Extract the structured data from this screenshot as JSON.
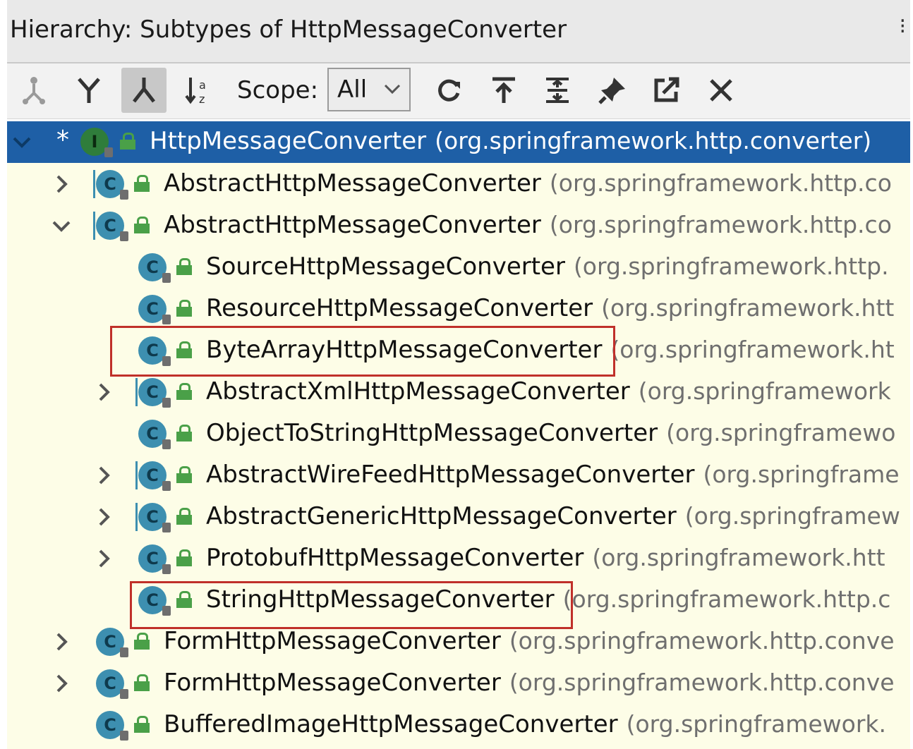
{
  "panel": {
    "title": "Hierarchy:  Subtypes of HttpMessageConverter",
    "more_icon": "more-vertical-icon",
    "colors": {
      "selection": "#1e5fa6",
      "tree_bg": "#fdfde7",
      "highlight": "#c0302a",
      "class_icon": "#3d8fb0",
      "interface_icon": "#2f7d3b"
    }
  },
  "toolbar": {
    "scope_label": "Scope:",
    "scope_value": "All",
    "buttons": [
      "type-hierarchy-icon",
      "supertypes-icon",
      "subtypes-icon",
      "sort-alphabetically-icon",
      "refresh-icon",
      "export-icon",
      "expand-all-icon",
      "pin-icon",
      "open-in-window-icon",
      "close-icon"
    ]
  },
  "tree": {
    "rows": [
      {
        "name": "HttpMessageConverter",
        "pkg": "(org.springframework.http.converter)",
        "kind": "interface",
        "expanded": true,
        "selected": true
      },
      {
        "name": "AbstractHttpMessageConverter",
        "pkg": "(org.springframework.http.co",
        "kind": "abstract",
        "expanded": false
      },
      {
        "name": "AbstractHttpMessageConverter",
        "pkg": "(org.springframework.http.co",
        "kind": "abstract",
        "expanded": true
      },
      {
        "name": "SourceHttpMessageConverter",
        "pkg": "(org.springframework.http.",
        "kind": "class"
      },
      {
        "name": "ResourceHttpMessageConverter",
        "pkg": "(org.springframework.htt",
        "kind": "class"
      },
      {
        "name": "ByteArrayHttpMessageConverter",
        "pkg": "(org.springframework.ht",
        "kind": "class",
        "highlighted": true
      },
      {
        "name": "AbstractXmlHttpMessageConverter",
        "pkg": "(org.springframework",
        "kind": "abstract",
        "expanded": false
      },
      {
        "name": "ObjectToStringHttpMessageConverter",
        "pkg": "(org.springframewo",
        "kind": "class"
      },
      {
        "name": "AbstractWireFeedHttpMessageConverter",
        "pkg": "(org.springframe",
        "kind": "abstract",
        "expanded": false
      },
      {
        "name": "AbstractGenericHttpMessageConverter",
        "pkg": "(org.springframew",
        "kind": "abstract",
        "expanded": false
      },
      {
        "name": "ProtobufHttpMessageConverter",
        "pkg": "(org.springframework.htt",
        "kind": "class",
        "expanded": false
      },
      {
        "name": "StringHttpMessageConverter",
        "pkg": "(org.springframework.http.c",
        "kind": "class",
        "highlighted": true
      },
      {
        "name": "FormHttpMessageConverter",
        "pkg": "(org.springframework.http.conve",
        "kind": "class",
        "expanded": false
      },
      {
        "name": "FormHttpMessageConverter",
        "pkg": "(org.springframework.http.conve",
        "kind": "class",
        "expanded": false
      },
      {
        "name": "BufferedImageHttpMessageConverter",
        "pkg": "(org.springframework.",
        "kind": "class"
      }
    ]
  }
}
